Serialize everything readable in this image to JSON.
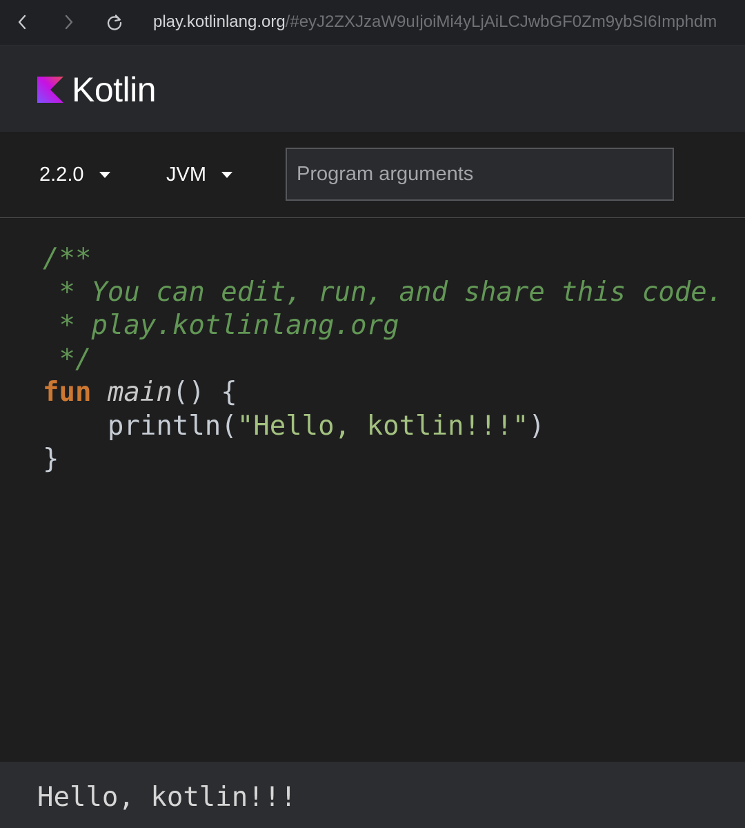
{
  "browser": {
    "url_host": "play.kotlinlang.org",
    "url_rest": "/#eyJ2ZXJzaW9uIjoiMi4yLjAiLCJwbGF0Zm9ybSI6Imphdm",
    "icons": [
      "chevron-left-icon",
      "chevron-right-icon",
      "reload-icon"
    ]
  },
  "header": {
    "logo_text": "Kotlin",
    "logo_colors": [
      "#7f52ff",
      "#c811e1",
      "#e54857"
    ]
  },
  "toolbar": {
    "version": "2.2.0",
    "target": "JVM",
    "args_placeholder": "Program arguments",
    "args_value": ""
  },
  "editor": {
    "comment": {
      "open": "/**",
      "line1": " * You can edit, run, and share this code.",
      "line2": " * play.kotlinlang.org",
      "close": " */"
    },
    "keyword_fun": "fun",
    "function_name": "main",
    "signature_tail": "() {",
    "indent": "    ",
    "call_name": "println(",
    "string_literal": "\"Hello, kotlin!!!\"",
    "call_close": ")",
    "closing_brace": "}"
  },
  "output": {
    "text": "Hello, kotlin!!!"
  },
  "colors": {
    "background": "#1e1e1f",
    "header_bg": "#27282c",
    "comment": "#629755",
    "keyword": "#cc7832",
    "string": "#a3c17f",
    "output_bg": "#2c2d30"
  }
}
